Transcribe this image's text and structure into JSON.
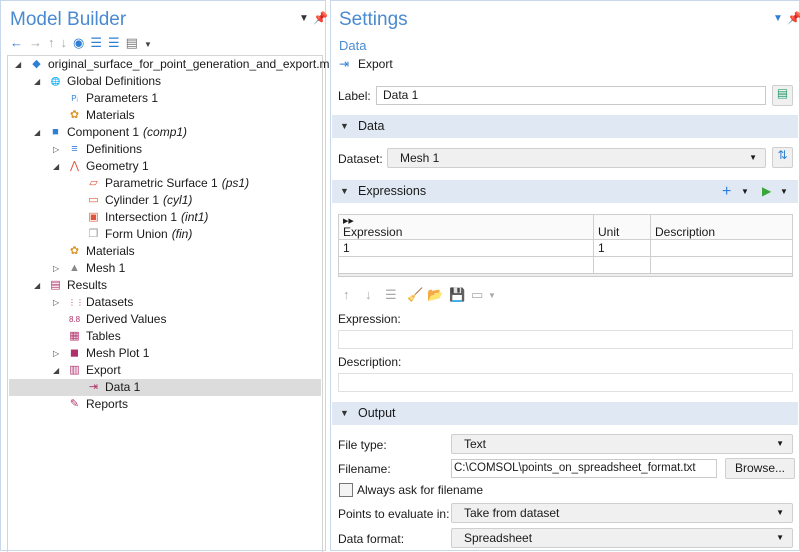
{
  "model_builder": {
    "title": "Model Builder",
    "toolbar": [
      "back",
      "forward",
      "move-up",
      "move-down",
      "show",
      "collapse-all",
      "expand-all",
      "view-options"
    ],
    "tree": [
      {
        "label": "original_surface_for_point_generation_and_export.mph",
        "tag": "",
        "level": 0,
        "arrow": "open",
        "icon": "model-icon"
      },
      {
        "label": "Global Definitions",
        "tag": "",
        "level": 1,
        "arrow": "open",
        "icon": "globe-icon"
      },
      {
        "label": "Parameters 1",
        "tag": "",
        "level": 2,
        "arrow": "",
        "icon": "parameters-icon"
      },
      {
        "label": "Materials",
        "tag": "",
        "level": 2,
        "arrow": "",
        "icon": "materials-icon"
      },
      {
        "label": "Component 1",
        "tag": "(comp1)",
        "level": 1,
        "arrow": "open",
        "icon": "component-icon"
      },
      {
        "label": "Definitions",
        "tag": "",
        "level": 2,
        "arrow": "closed",
        "icon": "definitions-icon"
      },
      {
        "label": "Geometry 1",
        "tag": "",
        "level": 2,
        "arrow": "open",
        "icon": "geometry-icon"
      },
      {
        "label": "Parametric Surface 1",
        "tag": "(ps1)",
        "level": 3,
        "arrow": "",
        "icon": "parametric-surface-icon"
      },
      {
        "label": "Cylinder 1",
        "tag": "(cyl1)",
        "level": 3,
        "arrow": "",
        "icon": "cylinder-icon"
      },
      {
        "label": "Intersection 1",
        "tag": "(int1)",
        "level": 3,
        "arrow": "",
        "icon": "intersection-icon"
      },
      {
        "label": "Form Union",
        "tag": "(fin)",
        "level": 3,
        "arrow": "",
        "icon": "form-union-icon"
      },
      {
        "label": "Materials",
        "tag": "",
        "level": 2,
        "arrow": "",
        "icon": "materials-icon"
      },
      {
        "label": "Mesh 1",
        "tag": "",
        "level": 2,
        "arrow": "closed",
        "icon": "mesh-icon"
      },
      {
        "label": "Results",
        "tag": "",
        "level": 1,
        "arrow": "open",
        "icon": "results-icon"
      },
      {
        "label": "Datasets",
        "tag": "",
        "level": 2,
        "arrow": "closed",
        "icon": "datasets-icon"
      },
      {
        "label": "Derived Values",
        "tag": "",
        "level": 2,
        "arrow": "",
        "icon": "derived-values-icon"
      },
      {
        "label": "Tables",
        "tag": "",
        "level": 2,
        "arrow": "",
        "icon": "tables-icon"
      },
      {
        "label": "Mesh Plot 1",
        "tag": "",
        "level": 2,
        "arrow": "closed",
        "icon": "mesh-plot-icon"
      },
      {
        "label": "Export",
        "tag": "",
        "level": 2,
        "arrow": "open",
        "icon": "export-icon"
      },
      {
        "label": "Data 1",
        "tag": "",
        "level": 3,
        "arrow": "",
        "icon": "data-export-icon",
        "selected": true
      },
      {
        "label": "Reports",
        "tag": "",
        "level": 2,
        "arrow": "",
        "icon": "reports-icon"
      }
    ]
  },
  "settings": {
    "title": "Settings",
    "subtitle": "Data",
    "action": "Export",
    "label_label": "Label:",
    "label_value": "Data 1",
    "sec_data": "Data",
    "dataset_label": "Dataset:",
    "dataset_value": "Mesh 1",
    "sec_expressions": "Expressions",
    "table": {
      "headers": [
        "Expression",
        "Unit",
        "Description"
      ],
      "rows": [
        [
          "1",
          "1",
          ""
        ],
        [
          "",
          "",
          ""
        ]
      ]
    },
    "expression_label": "Expression:",
    "expression_value": "",
    "description_label": "Description:",
    "description_value": "",
    "sec_output": "Output",
    "file_type_label": "File type:",
    "file_type_value": "Text",
    "filename_label": "Filename:",
    "filename_value": "C:\\COMSOL\\points_on_spreadsheet_format.txt",
    "browse": "Browse...",
    "always_ask": "Always ask for filename",
    "always_ask_checked": false,
    "points_label": "Points to evaluate in:",
    "points_value": "Take from dataset",
    "format_label": "Data format:",
    "format_value": "Spreadsheet"
  },
  "colors": {
    "accent": "#4a8ad0",
    "section": "#dfe8f3",
    "selected": "#dcdcdc"
  }
}
